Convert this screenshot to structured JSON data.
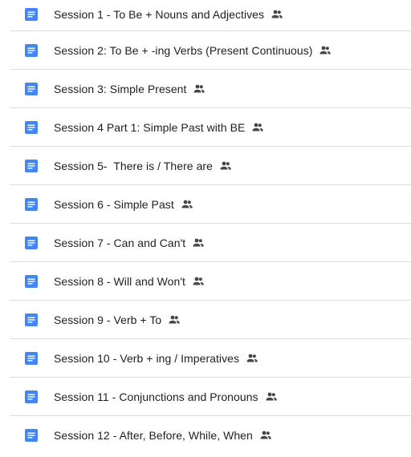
{
  "files": [
    {
      "name": "Session 1 - To Be + Nouns and Adjectives",
      "icon": "google-docs-icon",
      "shared_icon": "people-icon"
    },
    {
      "name": "Session 2: To Be + -ing Verbs (Present Continuous)",
      "icon": "google-docs-icon",
      "shared_icon": "people-icon"
    },
    {
      "name": "Session 3: Simple Present",
      "icon": "google-docs-icon",
      "shared_icon": "people-icon"
    },
    {
      "name": "Session 4 Part 1: Simple Past with BE",
      "icon": "google-docs-icon",
      "shared_icon": "people-icon"
    },
    {
      "name": "Session 5-  There is / There are",
      "icon": "google-docs-icon",
      "shared_icon": "people-icon"
    },
    {
      "name": "Session 6 - Simple Past",
      "icon": "google-docs-icon",
      "shared_icon": "people-icon"
    },
    {
      "name": "Session 7 - Can and Can't",
      "icon": "google-docs-icon",
      "shared_icon": "people-icon"
    },
    {
      "name": "Session 8 - Will and Won't",
      "icon": "google-docs-icon",
      "shared_icon": "people-icon"
    },
    {
      "name": "Session 9 - Verb + To",
      "icon": "google-docs-icon",
      "shared_icon": "people-icon"
    },
    {
      "name": "Session 10 - Verb + ing / Imperatives",
      "icon": "google-docs-icon",
      "shared_icon": "people-icon"
    },
    {
      "name": "Session 11 - Conjunctions and Pronouns",
      "icon": "google-docs-icon",
      "shared_icon": "people-icon"
    },
    {
      "name": "Session 12 - After, Before, While, When",
      "icon": "google-docs-icon",
      "shared_icon": "people-icon"
    }
  ],
  "colors": {
    "doc_icon": "#4285f4",
    "text": "#1f1f1f",
    "shared_icon": "#444746",
    "divider": "#dadce0"
  }
}
